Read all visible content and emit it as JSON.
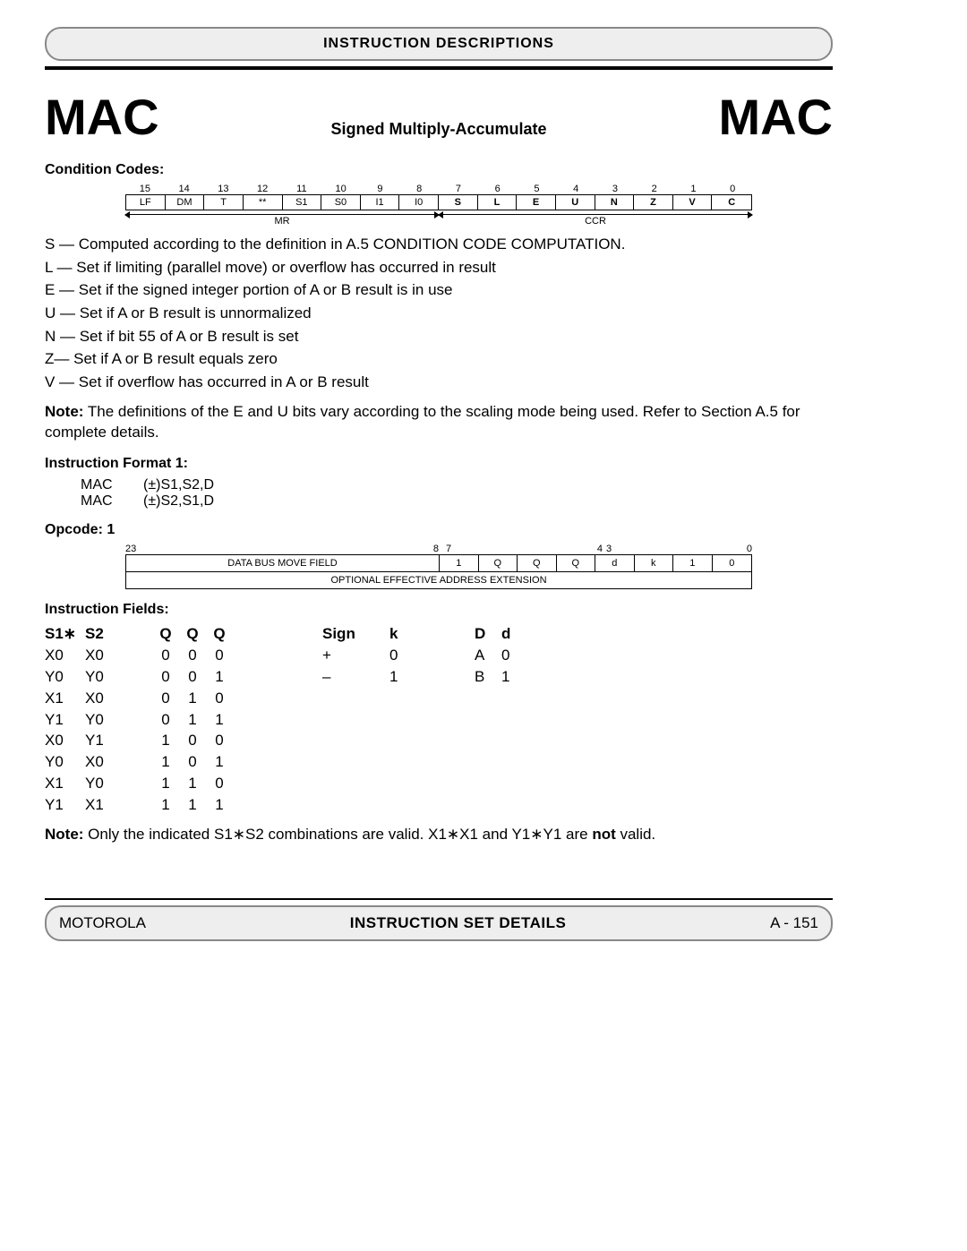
{
  "header": {
    "title": "INSTRUCTION DESCRIPTIONS"
  },
  "title": {
    "left": "MAC",
    "mid": "Signed Multiply-Accumulate",
    "right": "MAC"
  },
  "cond": {
    "heading": "Condition Codes:",
    "bitnums": [
      "15",
      "14",
      "13",
      "12",
      "11",
      "10",
      "9",
      "8",
      "7",
      "6",
      "5",
      "4",
      "3",
      "2",
      "1",
      "0"
    ],
    "bits": [
      "LF",
      "DM",
      "T",
      "**",
      "S1",
      "S0",
      "I1",
      "I0",
      "S",
      "L",
      "E",
      "U",
      "N",
      "Z",
      "V",
      "C"
    ],
    "mr": "MR",
    "ccr": "CCR",
    "lines": [
      "S — Computed according to the definition in A.5 CONDITION CODE COMPUTATION.",
      "L — Set if limiting (parallel move) or overflow has occurred in result",
      "E — Set if the signed integer portion of A or B result is in use",
      "U — Set if A or B result is unnormalized",
      "N — Set if bit 55 of A or B result is set",
      "Z— Set if A or B result equals zero",
      "V — Set if overflow has occurred in A or B result"
    ],
    "note_label": "Note:",
    "note": " The definitions of the E and U bits vary according to the scaling mode being used. Refer to Section A.5 for complete details."
  },
  "fmt": {
    "heading": "Instruction Format 1:",
    "rows": [
      {
        "mn": "MAC",
        "ops": "(±)S1,S2,D"
      },
      {
        "mn": "MAC",
        "ops": "(±)S2,S1,D"
      }
    ]
  },
  "opcode": {
    "heading": "Opcode: 1",
    "nums": {
      "n23": "23",
      "n8": "8",
      "n7": "7",
      "n4": "4",
      "n3": "3",
      "n0": "0"
    },
    "row1_left": "DATA BUS MOVE FIELD",
    "row1_bits": [
      "1",
      "Q",
      "Q",
      "Q",
      "d",
      "k",
      "1",
      "0"
    ],
    "row2": "OPTIONAL EFFECTIVE ADDRESS EXTENSION"
  },
  "fields": {
    "heading": "Instruction Fields:",
    "hdr": {
      "s1": "S1∗",
      "s2": "S2",
      "q1": "Q",
      "q2": "Q",
      "q3": "Q",
      "sign": "Sign",
      "k": "k",
      "D": "D",
      "d": "d"
    },
    "qqq": [
      {
        "s1": "X0",
        "s2": "X0",
        "q": [
          "0",
          "0",
          "0"
        ]
      },
      {
        "s1": "Y0",
        "s2": "Y0",
        "q": [
          "0",
          "0",
          "1"
        ]
      },
      {
        "s1": "X1",
        "s2": "X0",
        "q": [
          "0",
          "1",
          "0"
        ]
      },
      {
        "s1": "Y1",
        "s2": "Y0",
        "q": [
          "0",
          "1",
          "1"
        ]
      },
      {
        "s1": "X0",
        "s2": "Y1",
        "q": [
          "1",
          "0",
          "0"
        ]
      },
      {
        "s1": "Y0",
        "s2": "X0",
        "q": [
          "1",
          "0",
          "1"
        ]
      },
      {
        "s1": "X1",
        "s2": "Y0",
        "q": [
          "1",
          "1",
          "0"
        ]
      },
      {
        "s1": "Y1",
        "s2": "X1",
        "q": [
          "1",
          "1",
          "1"
        ]
      }
    ],
    "sign": [
      {
        "sign": "+",
        "k": "0"
      },
      {
        "sign": "–",
        "k": "1"
      }
    ],
    "dest": [
      {
        "D": "A",
        "d": "0"
      },
      {
        "D": "B",
        "d": "1"
      }
    ],
    "note_label": "Note:",
    "note_pre": " Only the indicated S1∗S2 combinations are valid. X1∗X1 and Y1∗Y1 are ",
    "note_bold": "not",
    "note_post": " valid."
  },
  "footer": {
    "left": "MOTOROLA",
    "center": "INSTRUCTION SET DETAILS",
    "right": "A - 151"
  }
}
